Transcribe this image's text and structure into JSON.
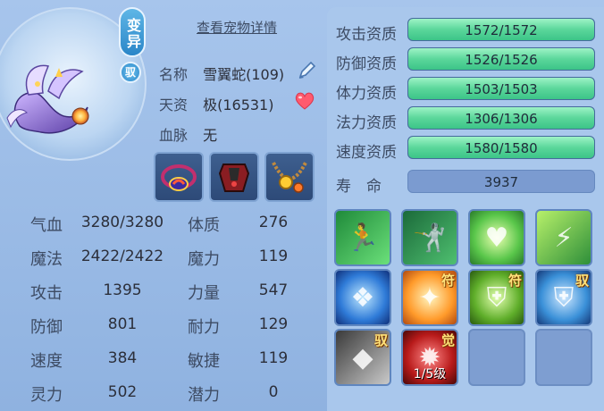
{
  "pet": {
    "mutant_badge": "变异",
    "bind_badge": "驭",
    "detail_link": "查看宠物详情",
    "name_label": "名称",
    "name_value": "雪翼蛇(109)",
    "talent_label": "天资",
    "talent_value": "极(16531)",
    "bloodline_label": "血脉",
    "bloodline_value": "无"
  },
  "stats": [
    {
      "label": "气血",
      "value": "3280/3280"
    },
    {
      "label": "魔法",
      "value": "2422/2422"
    },
    {
      "label": "攻击",
      "value": "1395"
    },
    {
      "label": "防御",
      "value": "801"
    },
    {
      "label": "速度",
      "value": "384"
    },
    {
      "label": "灵力",
      "value": "502"
    }
  ],
  "attrs": [
    {
      "label": "体质",
      "value": "276"
    },
    {
      "label": "魔力",
      "value": "119"
    },
    {
      "label": "力量",
      "value": "547"
    },
    {
      "label": "耐力",
      "value": "129"
    },
    {
      "label": "敏捷",
      "value": "119"
    },
    {
      "label": "潜力",
      "value": "0"
    }
  ],
  "aptitudes": [
    {
      "label": "攻击资质",
      "value": "1572/1572",
      "fill": 1.0
    },
    {
      "label": "防御资质",
      "value": "1526/1526",
      "fill": 1.0
    },
    {
      "label": "体力资质",
      "value": "1503/1503",
      "fill": 1.0
    },
    {
      "label": "法力资质",
      "value": "1306/1306",
      "fill": 1.0
    },
    {
      "label": "速度资质",
      "value": "1580/1580",
      "fill": 1.0
    }
  ],
  "life": {
    "label": "寿　命",
    "value": "3937"
  },
  "skills": [
    {
      "icon": "sprint-skill-icon",
      "tag": "",
      "bottom": ""
    },
    {
      "icon": "strike-skill-icon",
      "tag": "",
      "bottom": ""
    },
    {
      "icon": "heart-burst-skill-icon",
      "tag": "",
      "bottom": ""
    },
    {
      "icon": "lightning-skill-icon",
      "tag": "",
      "bottom": ""
    },
    {
      "icon": "blue-shield-skill-icon",
      "tag": "",
      "bottom": ""
    },
    {
      "icon": "wings-skill-icon",
      "tag": "符",
      "bottom": ""
    },
    {
      "icon": "green-crest-skill-icon",
      "tag": "符",
      "bottom": ""
    },
    {
      "icon": "silver-shield-skill-icon",
      "tag": "驭",
      "bottom": ""
    },
    {
      "icon": "blade-skill-icon",
      "tag": "驭",
      "bottom": ""
    },
    {
      "icon": "awaken-skill-icon",
      "tag": "觉",
      "bottom": "1/5级"
    }
  ],
  "colors": {
    "panel": "#a9c7ec",
    "bar_fill": "#5bd79b",
    "text": "#3d4b63"
  }
}
